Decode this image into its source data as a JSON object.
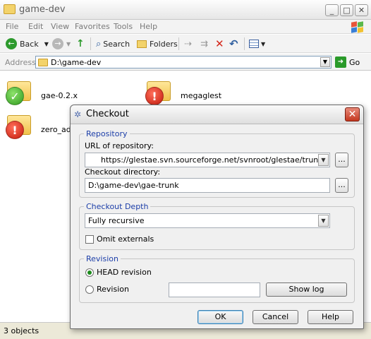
{
  "window": {
    "title": "game-dev",
    "controls": {
      "minimize": "_",
      "maximize": "□",
      "close": "✕"
    }
  },
  "menu": [
    "File",
    "Edit",
    "View",
    "Favorites",
    "Tools",
    "Help"
  ],
  "toolbar": {
    "back": "Back",
    "search": "Search",
    "folders": "Folders"
  },
  "address": {
    "label": "Address",
    "path": "D:\\game-dev",
    "go": "Go"
  },
  "files": [
    {
      "name": "gae-0.2.x",
      "status": "ok"
    },
    {
      "name": "megaglest",
      "status": "error"
    },
    {
      "name": "zero_ad",
      "status": "error"
    }
  ],
  "status_bar": {
    "text": "3 objects"
  },
  "dialog": {
    "title": "Checkout",
    "repository": {
      "legend": "Repository",
      "url_label": "URL of repository:",
      "url_value": "https://glestae.svn.sourceforge.net/svnroot/glestae/trunk",
      "dir_label": "Checkout directory:",
      "dir_value": "D:\\game-dev\\gae-trunk",
      "browse": "..."
    },
    "depth": {
      "legend": "Checkout Depth",
      "selected": "Fully recursive",
      "omit_externals": "Omit externals",
      "omit_externals_checked": false
    },
    "revision": {
      "legend": "Revision",
      "head_label": "HEAD revision",
      "revision_label": "Revision",
      "selected": "head",
      "revision_value": "",
      "show_log": "Show log"
    },
    "buttons": {
      "ok": "OK",
      "cancel": "Cancel",
      "help": "Help"
    }
  },
  "colors": {
    "group_legend": "#1c3ea8",
    "close_button": "#c4381f",
    "ok_overlay": "#2f9a1f",
    "error_overlay": "#c41a0c"
  }
}
